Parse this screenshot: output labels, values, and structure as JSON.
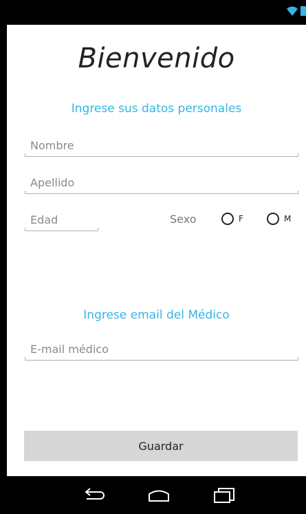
{
  "app": {
    "title": "Bienvenido"
  },
  "personal": {
    "heading": "Ingrese sus datos personales",
    "name_placeholder": "Nombre",
    "lastname_placeholder": "Apellido",
    "age_placeholder": "Edad",
    "sex_label": "Sexo",
    "sex_options": [
      "F",
      "M"
    ]
  },
  "doctor": {
    "heading": "Ingrese email del Médico",
    "email_placeholder": "E-mail médico"
  },
  "actions": {
    "save_label": "Guardar"
  },
  "icons": {
    "status": [
      "wifi-icon",
      "battery-icon"
    ],
    "nav": [
      "back-icon",
      "home-icon",
      "recents-icon"
    ]
  },
  "colors": {
    "accent": "#33b5e5",
    "button_bg": "#d6d6d6",
    "bars": "#000000"
  }
}
